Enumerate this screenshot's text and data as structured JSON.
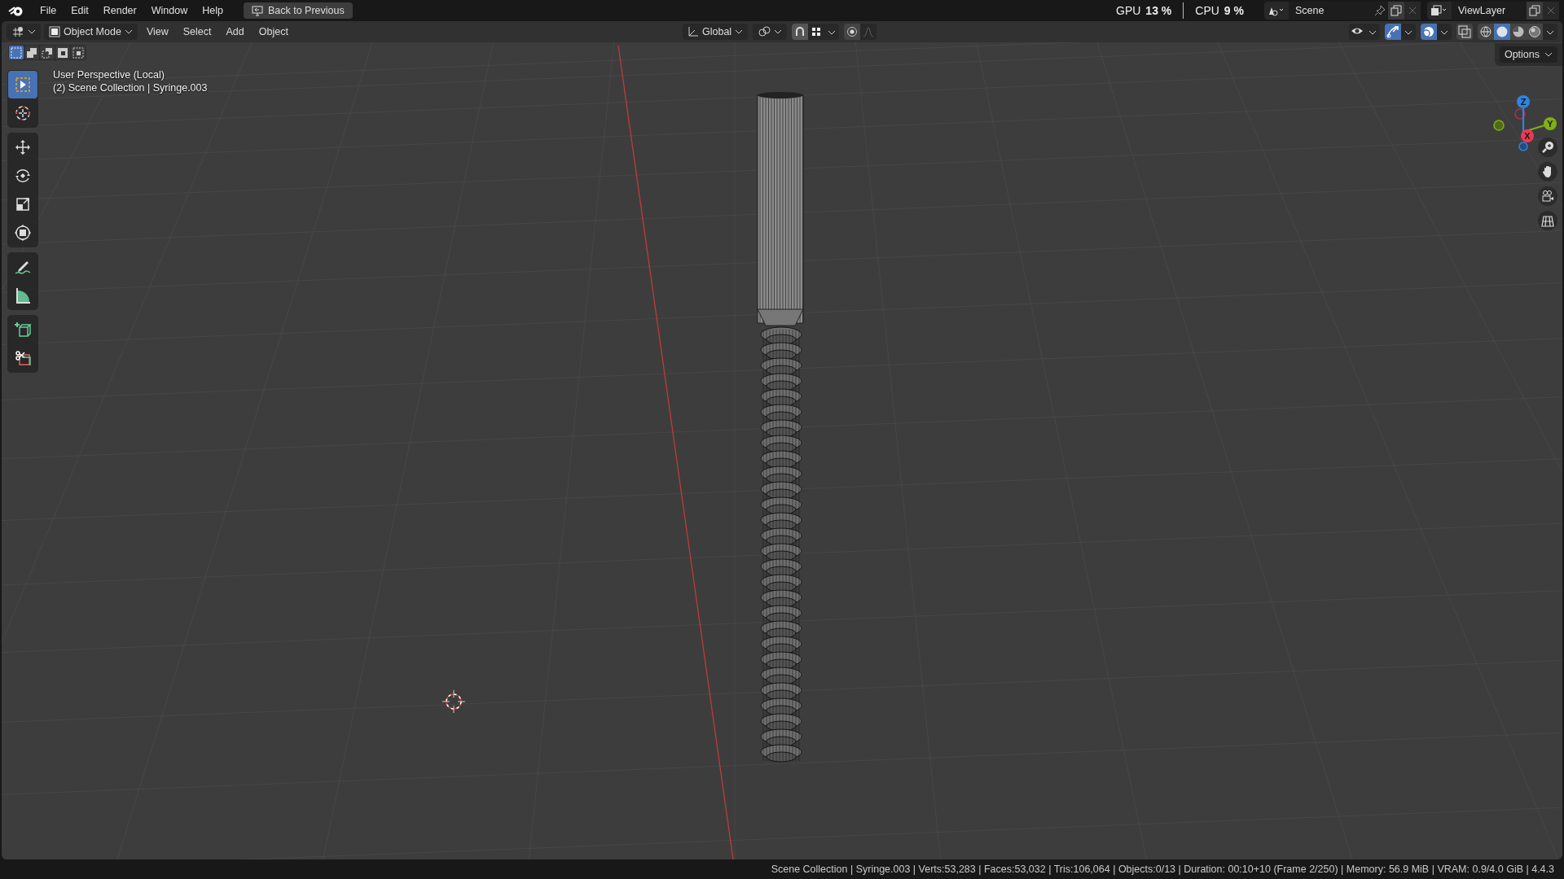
{
  "top_bar": {
    "menus": [
      {
        "label": "File"
      },
      {
        "label": "Edit"
      },
      {
        "label": "Render"
      },
      {
        "label": "Window"
      },
      {
        "label": "Help"
      }
    ],
    "back_button": "Back to Previous",
    "stats": [
      {
        "label": "GPU",
        "value": "13 %"
      },
      {
        "label": "CPU",
        "value": "9 %"
      }
    ],
    "scene": "Scene",
    "view_layer": "ViewLayer"
  },
  "header": {
    "mode": "Object Mode",
    "menus": [
      {
        "label": "View"
      },
      {
        "label": "Select"
      },
      {
        "label": "Add"
      },
      {
        "label": "Object"
      }
    ],
    "orientation": "Global",
    "snap_on": true,
    "proportional_on": false,
    "toggles": [
      {
        "kind": "visibility",
        "selected": false
      },
      {
        "kind": "gizmo",
        "selected": true
      },
      {
        "kind": "overlay",
        "selected": true
      },
      {
        "kind": "xray",
        "selected": false
      }
    ],
    "shading": [
      {
        "kind": "wireframe",
        "selected": false
      },
      {
        "kind": "solid",
        "selected": true
      },
      {
        "kind": "material",
        "selected": false
      },
      {
        "kind": "rendered",
        "selected": false
      }
    ],
    "options": "Options"
  },
  "select_modes": [
    {
      "kind": "new",
      "selected": true
    },
    {
      "kind": "extend",
      "selected": false
    },
    {
      "kind": "subtract",
      "selected": false
    },
    {
      "kind": "invert",
      "selected": false
    },
    {
      "kind": "intersect",
      "selected": false
    }
  ],
  "tools": [
    {
      "kind": "select",
      "selected": true
    },
    {
      "kind": "cursor",
      "selected": false
    },
    {
      "kind": "move",
      "selected": false
    },
    {
      "kind": "rotate",
      "selected": false
    },
    {
      "kind": "scale",
      "selected": false
    },
    {
      "kind": "transform",
      "selected": false
    },
    {
      "kind": "annotate",
      "selected": false
    },
    {
      "kind": "measure",
      "selected": false
    },
    {
      "kind": "add_cube",
      "selected": false
    },
    {
      "kind": "cut",
      "selected": false
    }
  ],
  "viewport": {
    "view_name": "User Perspective (Local)",
    "context": "(2) Scene Collection | Syringe.003",
    "gizmo": [
      {
        "label": "Z"
      },
      {
        "label": "Y"
      },
      {
        "label": "X"
      }
    ],
    "nav_buttons": [
      {
        "kind": "zoom"
      },
      {
        "kind": "pan"
      },
      {
        "kind": "camera"
      },
      {
        "kind": "ortho"
      }
    ]
  },
  "status_bar": "Scene Collection | Syringe.003 | Verts:53,283 | Faces:53,032 | Tris:106,064 | Objects:0/13 | Duration: 00:10+10 (Frame 2/250) | Memory: 56.9 MiB | VRAM: 0.9/4.0 GiB | 4.4.3"
}
